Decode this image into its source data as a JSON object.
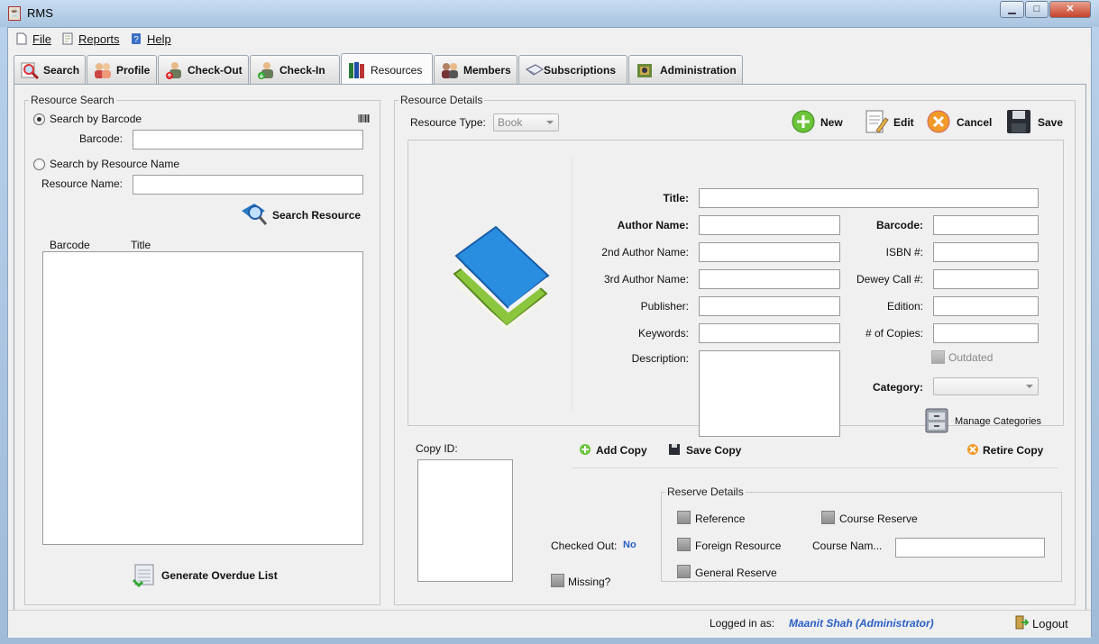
{
  "window": {
    "title": "RMS",
    "buttons": {
      "minimize": "▁",
      "maximize": "□",
      "close": "✕"
    }
  },
  "menu": {
    "file": "File",
    "reports": "Reports",
    "help": "Help"
  },
  "tabs": [
    {
      "label": "Search",
      "icon": "search-icon"
    },
    {
      "label": "Profile",
      "icon": "users-icon"
    },
    {
      "label": "Check-Out",
      "icon": "user-checkout-icon"
    },
    {
      "label": "Check-In",
      "icon": "user-checkin-icon"
    },
    {
      "label": "Resources",
      "icon": "books-icon",
      "active": true
    },
    {
      "label": "Members",
      "icon": "members-icon"
    },
    {
      "label": "Subscriptions",
      "icon": "subscriptions-icon"
    },
    {
      "label": "Administration",
      "icon": "administration-icon"
    }
  ],
  "resource_search": {
    "legend": "Resource Search",
    "by_barcode": "Search by Barcode",
    "barcode_label": "Barcode:",
    "barcode_value": "",
    "by_name": "Search by Resource Name",
    "name_label": "Resource Name:",
    "name_value": "",
    "search_button": "Search Resource",
    "columns": [
      "Barcode",
      "Title"
    ],
    "generate_button": "Generate Overdue List"
  },
  "resource_details": {
    "legend": "Resource Details",
    "type_label": "Resource Type:",
    "type_value": "Book",
    "toolbar": {
      "new": "New",
      "edit": "Edit",
      "cancel": "Cancel",
      "save": "Save"
    },
    "fields": {
      "title": "Title:",
      "author": "Author Name:",
      "author2": "2nd Author Name:",
      "author3": "3rd Author Name:",
      "publisher": "Publisher:",
      "keywords": "Keywords:",
      "description": "Description:",
      "barcode": "Barcode:",
      "isbn": "ISBN #:",
      "dewey": "Dewey Call #:",
      "edition": "Edition:",
      "copies": "# of Copies:",
      "outdated": "Outdated",
      "category": "Category:"
    },
    "manage_categories": "Manage Categories",
    "copy_id": "Copy ID:",
    "add_copy": "Add Copy",
    "save_copy": "Save Copy",
    "retire_copy": "Retire Copy",
    "checked_out_label": "Checked Out:",
    "checked_out_value": "No",
    "missing": "Missing?",
    "reserve": {
      "legend": "Reserve Details",
      "reference": "Reference",
      "foreign": "Foreign Resource",
      "general": "General Reserve",
      "course_reserve": "Course Reserve",
      "course_name": "Course Nam..."
    }
  },
  "status": {
    "logged_label": "Logged in as:",
    "user": "Maanit Shah (Administrator)",
    "logout": "Logout"
  },
  "colors": {
    "accent_blue": "#2a5fc4",
    "titlebar": "#a9c4e0"
  }
}
